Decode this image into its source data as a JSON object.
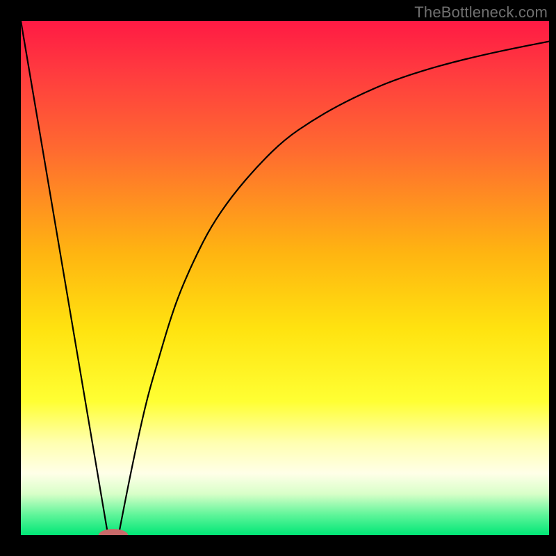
{
  "watermark": "TheBottleneck.com",
  "chart_data": {
    "type": "line",
    "title": "",
    "xlabel": "",
    "ylabel": "",
    "xlim": [
      0,
      100
    ],
    "ylim": [
      0,
      100
    ],
    "background_gradient": {
      "stops": [
        {
          "offset": 0.0,
          "color": "#ff1a44"
        },
        {
          "offset": 0.1,
          "color": "#ff3b3f"
        },
        {
          "offset": 0.25,
          "color": "#ff6a30"
        },
        {
          "offset": 0.45,
          "color": "#ffb411"
        },
        {
          "offset": 0.6,
          "color": "#ffe310"
        },
        {
          "offset": 0.74,
          "color": "#ffff33"
        },
        {
          "offset": 0.82,
          "color": "#ffffb0"
        },
        {
          "offset": 0.88,
          "color": "#ffffe8"
        },
        {
          "offset": 0.92,
          "color": "#d8ffc8"
        },
        {
          "offset": 0.96,
          "color": "#60f59a"
        },
        {
          "offset": 1.0,
          "color": "#00e676"
        }
      ]
    },
    "series": [
      {
        "name": "left-descent",
        "type": "line",
        "x": [
          0,
          16.5
        ],
        "y": [
          100,
          0
        ]
      },
      {
        "name": "right-curve",
        "type": "line",
        "x": [
          18.5,
          20,
          22,
          24,
          26,
          28,
          30,
          33,
          36,
          40,
          45,
          50,
          55,
          60,
          66,
          72,
          80,
          88,
          95,
          100
        ],
        "y": [
          0,
          8,
          18,
          27,
          34,
          41,
          47,
          54,
          60,
          66,
          72,
          77,
          80.5,
          83.5,
          86.5,
          89,
          91.5,
          93.5,
          95,
          96
        ]
      }
    ],
    "marker": {
      "name": "min-marker",
      "x": 17.5,
      "y": 0,
      "rx_frac": 0.028,
      "ry_frac": 0.012,
      "fill": "#c96a6a"
    }
  }
}
